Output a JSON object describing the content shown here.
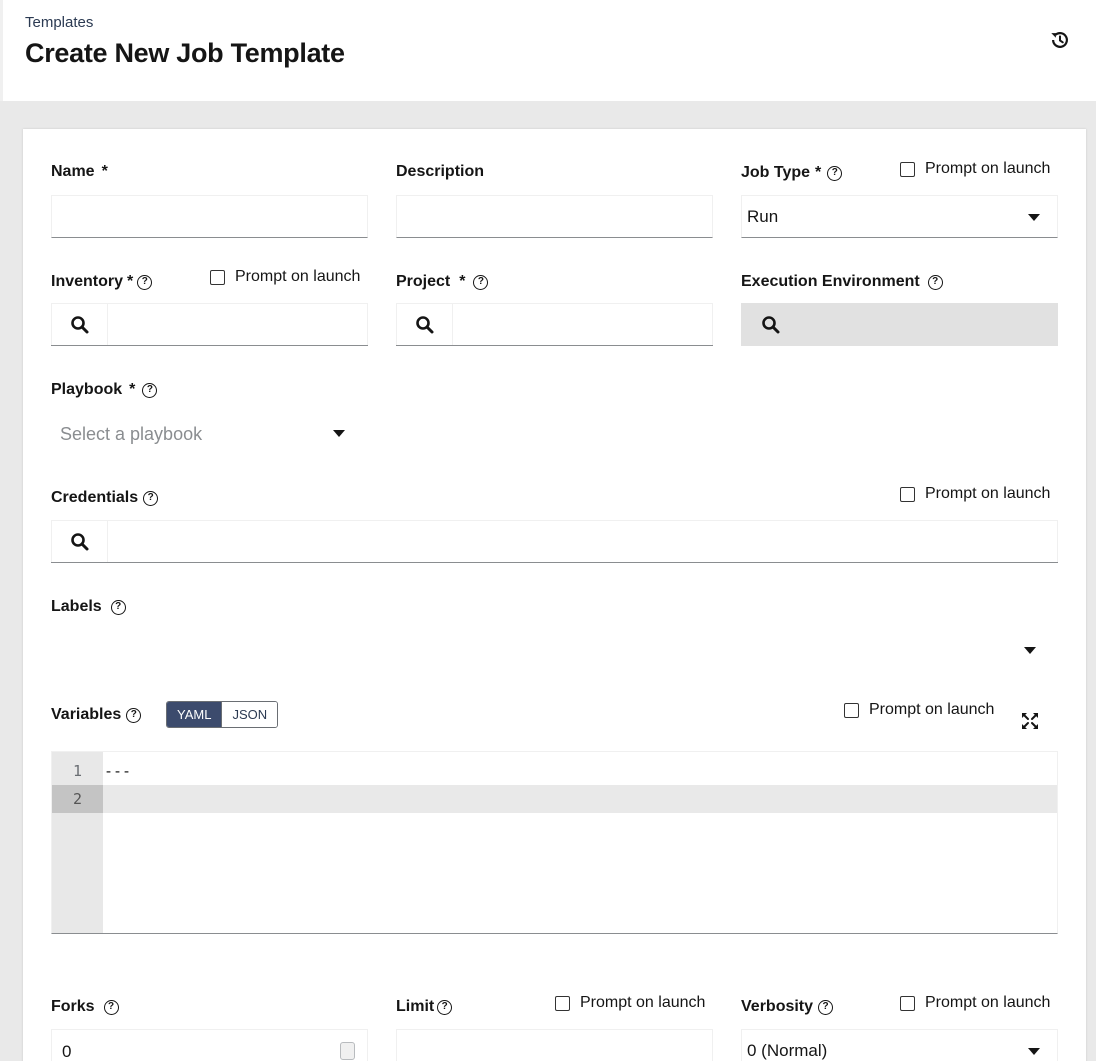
{
  "header": {
    "breadcrumb": "Templates",
    "title": "Create New Job Template"
  },
  "form": {
    "prompt_label": "Prompt on launch",
    "name": {
      "label": "Name",
      "required": "*",
      "value": ""
    },
    "description": {
      "label": "Description",
      "value": ""
    },
    "job_type": {
      "label": "Job Type",
      "required": "*",
      "value": "Run"
    },
    "inventory": {
      "label": "Inventory",
      "required": "*",
      "value": ""
    },
    "project": {
      "label": "Project",
      "required": "*",
      "value": ""
    },
    "execution_environment": {
      "label": "Execution Environment",
      "value": ""
    },
    "playbook": {
      "label": "Playbook",
      "required": "*",
      "placeholder": "Select a playbook"
    },
    "credentials": {
      "label": "Credentials",
      "value": ""
    },
    "labels": {
      "label": "Labels"
    },
    "variables": {
      "label": "Variables",
      "mode_yaml": "YAML",
      "mode_json": "JSON",
      "active_mode": "YAML",
      "lines": [
        {
          "num": "1",
          "code": "---"
        },
        {
          "num": "2",
          "code": ""
        }
      ]
    },
    "forks": {
      "label": "Forks",
      "value": "0"
    },
    "limit": {
      "label": "Limit",
      "value": ""
    },
    "verbosity": {
      "label": "Verbosity",
      "value": "0 (Normal)"
    }
  },
  "icons": {
    "history": "history-icon",
    "help": "help-circle-icon",
    "search": "search-icon",
    "dropdown": "caret-down-icon",
    "expand": "expand-icon"
  },
  "colors": {
    "toggle_active": "#3c4b6d",
    "disabled_field": "#e1e1e1",
    "page_background": "#e9e9e9"
  }
}
